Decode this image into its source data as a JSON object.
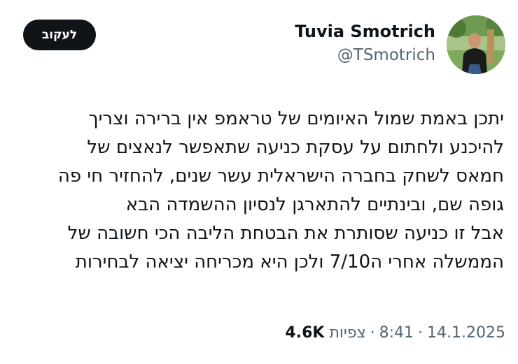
{
  "header": {
    "follow_label": "לעקוב",
    "display_name": "Tuvia Smotrich",
    "handle": "@TSmotrich",
    "avatar_icon": "profile-photo-icon"
  },
  "tweet": {
    "lines": [
      "יתכן באמת שמול האיומים של טראמפ אין ברירה וצריך",
      "להיכנע ולחתום על עסקת כניעה שתאפשר לנאצים של",
      "חמאס לשחק בחברה הישראלית עשר שנים, להחזיר חי פה",
      "גופה שם, ובינתיים להתארגן לנסיון ההשמדה הבא",
      "אבל זו כניעה שסותרת את הבטחת הליבה הכי חשובה של",
      "הממשלה אחרי ה7/10 ולכן היא מכריחה יציאה לבחירות"
    ]
  },
  "meta": {
    "date": "14.1.2025",
    "separator": "·",
    "time": "8:41",
    "views_label": "צפיות",
    "views_count": "4.6K"
  },
  "colors": {
    "text": "#0f1419",
    "secondary": "#536471",
    "button_bg": "#0f1419",
    "button_text": "#ffffff"
  }
}
